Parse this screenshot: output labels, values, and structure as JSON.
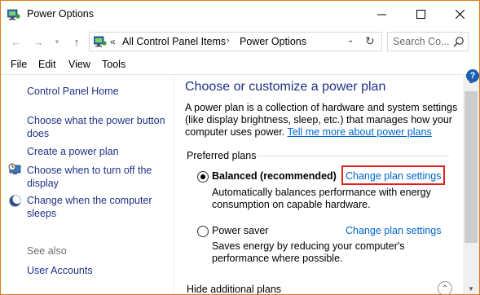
{
  "window": {
    "title": "Power Options",
    "icon": "power-options-app-icon",
    "controls": [
      "minimize-icon",
      "maximize-icon",
      "close-icon"
    ]
  },
  "nav": {
    "back_icon": "arrow-left-icon",
    "forward_icon": "arrow-right-icon",
    "recent_icon": "chevron-down-icon",
    "up_icon": "arrow-up-icon"
  },
  "address": {
    "overflow": "«",
    "crumbs": [
      "All Control Panel Items",
      "Power Options"
    ],
    "separator": "›",
    "refresh_icon": "refresh-icon"
  },
  "search": {
    "placeholder": "Search Co...",
    "icon": "search-icon"
  },
  "menu": {
    "items": [
      "File",
      "Edit",
      "View",
      "Tools"
    ]
  },
  "sidebar": {
    "home": "Control Panel Home",
    "links": [
      "Choose what the power button does",
      "Create a power plan",
      "Choose when to turn off the display",
      "Change when the computer sleeps"
    ],
    "see_also_label": "See also",
    "see_also_links": [
      "User Accounts"
    ]
  },
  "main": {
    "title": "Choose or customize a power plan",
    "description": "A power plan is a collection of hardware and system settings (like display brightness, sleep, etc.) that manages how your computer uses power. ",
    "learn_more": "Tell me more about power plans",
    "preferred_plans_label": "Preferred plans",
    "plans": [
      {
        "name": "Balanced (recommended)",
        "selected": true,
        "change_link": "Change plan settings",
        "description": "Automatically balances performance with energy consumption on capable hardware."
      },
      {
        "name": "Power saver",
        "selected": false,
        "change_link": "Change plan settings",
        "description": "Saves energy by reducing your computer's performance where possible."
      }
    ],
    "hide_additional": "Hide additional plans"
  },
  "colors": {
    "window_border": "#e07a1f",
    "link_blue": "#0066cc",
    "heading_blue": "#1e3287",
    "highlight_red": "#e02020"
  }
}
